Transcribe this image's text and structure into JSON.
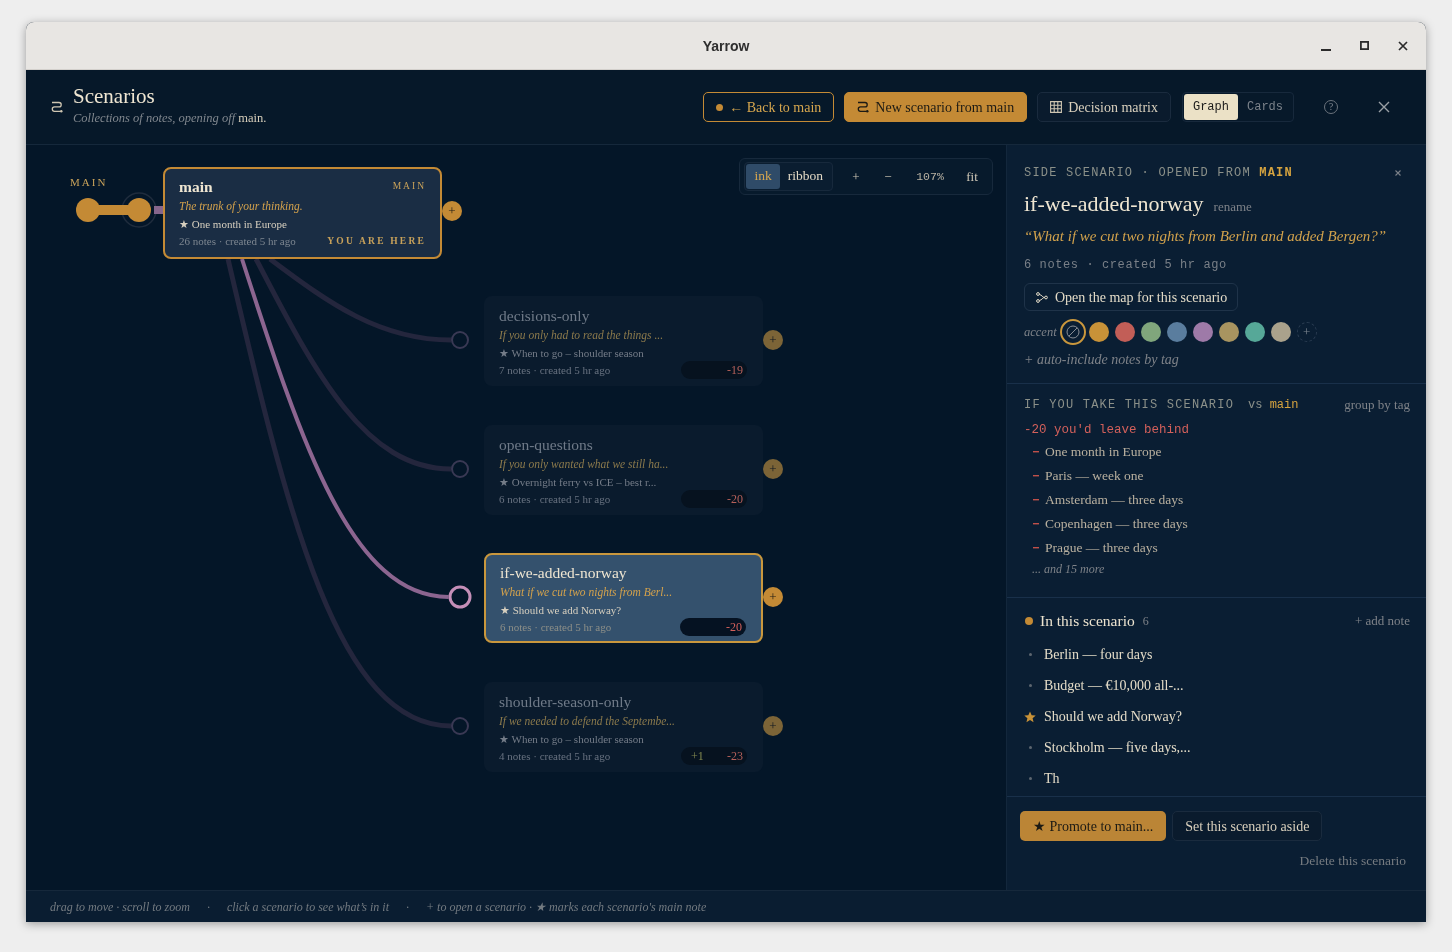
{
  "window": {
    "title": "Yarrow"
  },
  "header": {
    "title": "Scenarios",
    "subtitle": "*Collections of notes, opening off* main.",
    "back_button": "← Back to main",
    "new_button": "New scenario from main",
    "matrix_button": "Decision matrix",
    "views": [
      {
        "label": "Graph",
        "selected": true
      },
      {
        "label": "Cards",
        "selected": false
      }
    ],
    "help": "?"
  },
  "canvas": {
    "toolbar": {
      "modes": [
        {
          "label": "ink",
          "selected": true
        },
        {
          "label": "ribbon",
          "selected": false
        }
      ],
      "zoom_in": "+",
      "zoom_out": "−",
      "zoom": "107%",
      "fit": "fit"
    },
    "trunk_label": "MAIN",
    "main_node": {
      "name": "main",
      "tag": "MAIN",
      "question": "The trunk of your thinking.",
      "main_note": "★ One month in Europe",
      "meta": "26 notes · created 5 hr ago",
      "here": "YOU ARE HERE",
      "open": "+"
    },
    "scenarios": [
      {
        "name": "decisions-only",
        "question": "If you only had to read the things ...",
        "main_note": "★ When to go – shoulder season",
        "meta": "7 notes · created 5 hr ago",
        "removed": "-19",
        "open": "+",
        "selected": false
      },
      {
        "name": "open-questions",
        "question": "If you only wanted what we still ha...",
        "main_note": "★ Overnight ferry vs ICE – best r...",
        "meta": "6 notes · created 5 hr ago",
        "removed": "-20",
        "open": "+",
        "selected": false
      },
      {
        "name": "if-we-added-norway",
        "question": "What if we cut two nights from Berl...",
        "main_note": "★ Should we add Norway?",
        "meta": "6 notes · created 5 hr ago",
        "removed": "-20",
        "open": "+",
        "selected": true
      },
      {
        "name": "shoulder-season-only",
        "question": "If we needed to defend the Septembe...",
        "main_note": "★ When to go – shoulder season",
        "meta": "4 notes · created 5 hr ago",
        "added": "+1",
        "removed": "-23",
        "open": "+",
        "selected": false
      }
    ]
  },
  "panel": {
    "eyebrow": "SIDE SCENARIO · OPENED FROM **MAIN**",
    "title": "if-we-added-norway",
    "rename": "rename",
    "question": "“What if we cut two nights from Berlin and added Bergen?”",
    "meta": "6 notes · created 5 hr ago",
    "map_button": "Open the map for this scenario",
    "accent_label": "accent",
    "accents": [
      {
        "kind": "none",
        "selected": true
      },
      {
        "kind": "color",
        "color": "#c89238",
        "selected": false
      },
      {
        "kind": "color",
        "color": "#c25e57",
        "selected": false
      },
      {
        "kind": "color",
        "color": "#80a67c",
        "selected": false
      },
      {
        "kind": "color",
        "color": "#5a7d9e",
        "selected": false
      },
      {
        "kind": "color",
        "color": "#9e7aa8",
        "selected": false
      },
      {
        "kind": "color",
        "color": "#a89460",
        "selected": false
      },
      {
        "kind": "color",
        "color": "#56a898",
        "selected": false
      },
      {
        "kind": "color",
        "color": "#aaa28c",
        "selected": false
      }
    ],
    "accent_add": "+",
    "auto_include": "+ auto-include notes by tag",
    "compare": {
      "title": "IF YOU TAKE THIS SCENARIO",
      "base": "vs **main**",
      "group_by": "group by tag",
      "summary": "-20 you'd leave behind",
      "removed": [
        "One month in Europe",
        "Paris — week one",
        "Amsterdam — three days",
        "Copenhagen — three days",
        "Prague — three days"
      ],
      "more": "... and 15 more"
    },
    "notes": {
      "title": "In this scenario",
      "count": "6",
      "add": "+ add note",
      "items": [
        {
          "text": "Berlin — four days",
          "starred": false
        },
        {
          "text": "Budget — €10,000 all-...",
          "starred": false
        },
        {
          "text": "Should we add Norway?",
          "starred": true
        },
        {
          "text": "Stockholm — five days,...",
          "starred": false
        },
        {
          "text": "Th",
          "starred": false
        }
      ]
    },
    "actions": {
      "promote": "★ Promote to main...",
      "aside": "Set this scenario aside",
      "delete": "Delete this scenario"
    }
  },
  "footer": [
    "drag to move · scroll to zoom",
    "·",
    "click a scenario to see what’s in it",
    "·",
    "+ to open a scenario · ★ marks each scenario's main note"
  ]
}
